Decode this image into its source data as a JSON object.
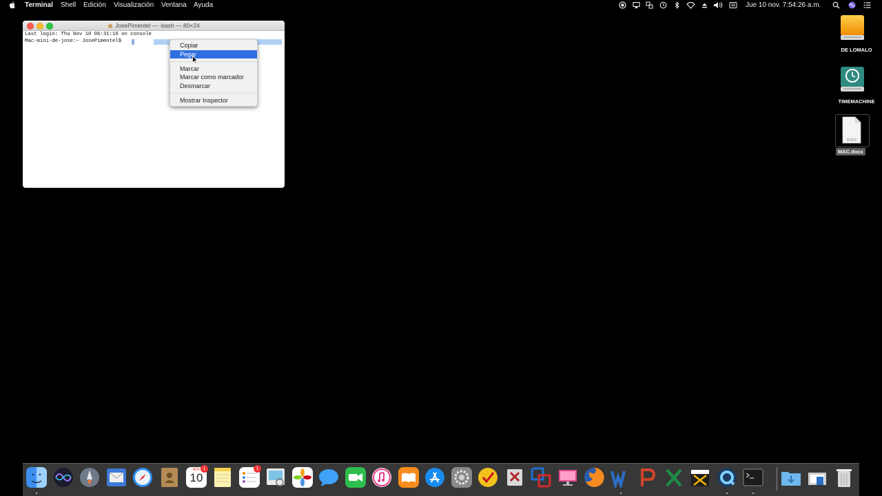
{
  "menubar": {
    "app_name": "Terminal",
    "menus": [
      "Shell",
      "Edición",
      "Visualización",
      "Ventana",
      "Ayuda"
    ],
    "clock": "Jue 10 nov.  7:54:26 a.m.",
    "status_icons": [
      "record-icon",
      "airplay-icon",
      "dropbox-icon",
      "time-machine-icon",
      "bluetooth-icon",
      "wifi-icon",
      "eject-icon",
      "volume-icon",
      "input-flag-icon",
      "spotlight-icon",
      "siri-icon",
      "notification-center-icon"
    ]
  },
  "terminal": {
    "title": "JosePimentel — -bash — 80×24",
    "line1": "Last login: Thu Nov 10 06:31:10 on console",
    "line2": "Mac-mini-de-jose:~ JosePimentel$ "
  },
  "context_menu": {
    "items": [
      {
        "label": "Copiar"
      },
      {
        "label": "Pegar"
      },
      {
        "label": "Marcar"
      },
      {
        "label": "Marcar como marcador"
      },
      {
        "label": "Desmarcar"
      },
      {
        "label": "Mostrar Inspector"
      }
    ],
    "highlighted": "Pegar"
  },
  "desktop": {
    "icons": [
      {
        "label": "DE LOMALO",
        "icon": "external-drive-icon"
      },
      {
        "label": "TIMEMACHINE",
        "icon": "time-machine-drive-icon"
      },
      {
        "label": "MAC.docx",
        "icon": "docx-file-icon",
        "badge": "DOCX"
      }
    ]
  },
  "dock": {
    "calendar_month": "NOV",
    "calendar_day": "10",
    "calendar_badge": "1",
    "reminders_badge": "1",
    "apps": [
      "finder",
      "siri",
      "launchpad",
      "mail",
      "safari",
      "contacts",
      "calendar",
      "notes",
      "reminders",
      "preview",
      "photos",
      "messages",
      "facetime",
      "itunes",
      "ibooks",
      "app-store",
      "system-preferences",
      "tasks",
      "scrobbles",
      "parallels",
      "screen",
      "firefox",
      "word",
      "powerpoint",
      "excel",
      "final-cut-pro",
      "quicktime",
      "terminal",
      "downloads",
      "stack",
      "trash"
    ]
  }
}
